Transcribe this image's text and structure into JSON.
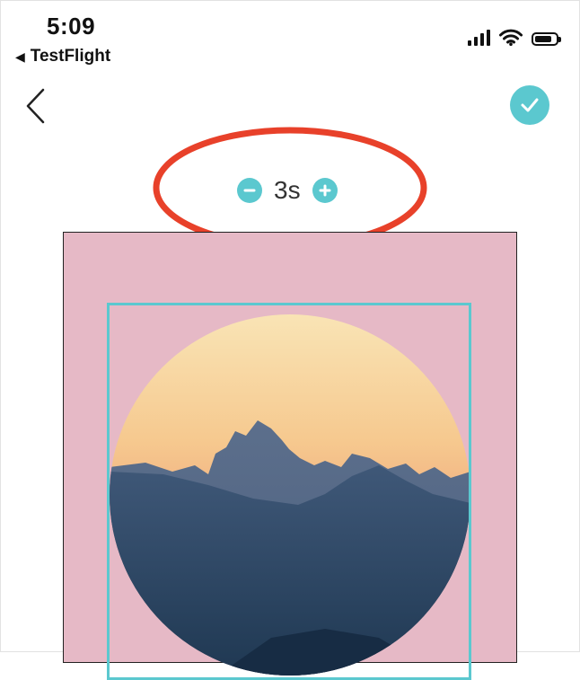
{
  "status_bar": {
    "time": "5:09",
    "back_app_label": "TestFlight",
    "icons": [
      "cellular-signal-icon",
      "wifi-icon",
      "battery-icon"
    ]
  },
  "nav": {
    "back_icon": "chevron-left-icon",
    "confirm_icon": "checkmark-circle-icon"
  },
  "duration": {
    "value": "3s",
    "decrease_icon": "minus-circle-icon",
    "increase_icon": "plus-circle-icon"
  },
  "colors": {
    "accent": "#5bc8cf",
    "canvas_background": "#e6b9c6",
    "annotation_ring": "#e8412a"
  },
  "canvas": {
    "image": "circular sunset mountain photo"
  }
}
